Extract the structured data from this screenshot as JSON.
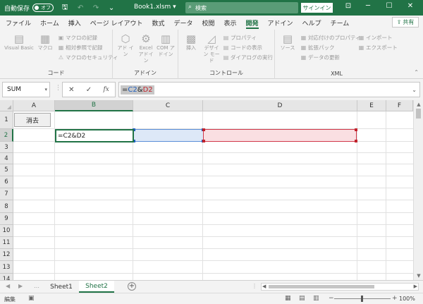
{
  "titlebar": {
    "autosave_label": "自動保存",
    "autosave_state": "オフ",
    "filename": "Book1.xlsm",
    "filename_caret": "▾",
    "search_placeholder": "検索",
    "signin_label": "サインイン"
  },
  "ribbon_tabs": [
    "ファイル",
    "ホーム",
    "挿入",
    "ページ レイアウト",
    "数式",
    "データ",
    "校閲",
    "表示",
    "開発",
    "アドイン",
    "ヘルプ",
    "チーム"
  ],
  "active_tab": "開発",
  "share_label": "共有",
  "ribbon": {
    "code": {
      "label": "コード",
      "visual_basic": "Visual Basic",
      "macro": "マクロ",
      "record_macro": "マクロの記録",
      "relative_ref": "相対参照で記録",
      "macro_security": "マクロのセキュリティ"
    },
    "addins": {
      "label": "アドイン",
      "addin": "アド イン",
      "excel_addin": "Excel アドイン",
      "com_addin": "COM アドイン"
    },
    "controls": {
      "label": "コントロール",
      "insert": "挿入",
      "design_mode": "デザイン モード",
      "properties": "プロパティ",
      "view_code": "コードの表示",
      "run_dialog": "ダイアログの実行"
    },
    "xml": {
      "label": "XML",
      "source": "ソース",
      "map_props": "対応付けのプロパティ",
      "expansion_pack": "拡張パック",
      "refresh_data": "データの更新",
      "import": "インポート",
      "export": "エクスポート"
    }
  },
  "formula_bar": {
    "namebox": "SUM",
    "formula_prefix": "=",
    "ref1": "C2",
    "amp": "&",
    "ref2": "D2"
  },
  "grid": {
    "columns": [
      "A",
      "B",
      "C",
      "D",
      "E",
      "F"
    ],
    "rows": [
      "1",
      "2",
      "3",
      "4",
      "5",
      "6",
      "7",
      "8",
      "9",
      "10",
      "11",
      "12",
      "13",
      "14"
    ],
    "active_cell_text": "=C2&D2",
    "button_label": "消去"
  },
  "sheets": [
    "Sheet1",
    "Sheet2"
  ],
  "active_sheet": "Sheet2",
  "status": {
    "mode": "編集",
    "zoom": "100%"
  },
  "colors": {
    "accent": "#217346",
    "ref1": "#1f5fbf",
    "ref2": "#c0232c"
  }
}
